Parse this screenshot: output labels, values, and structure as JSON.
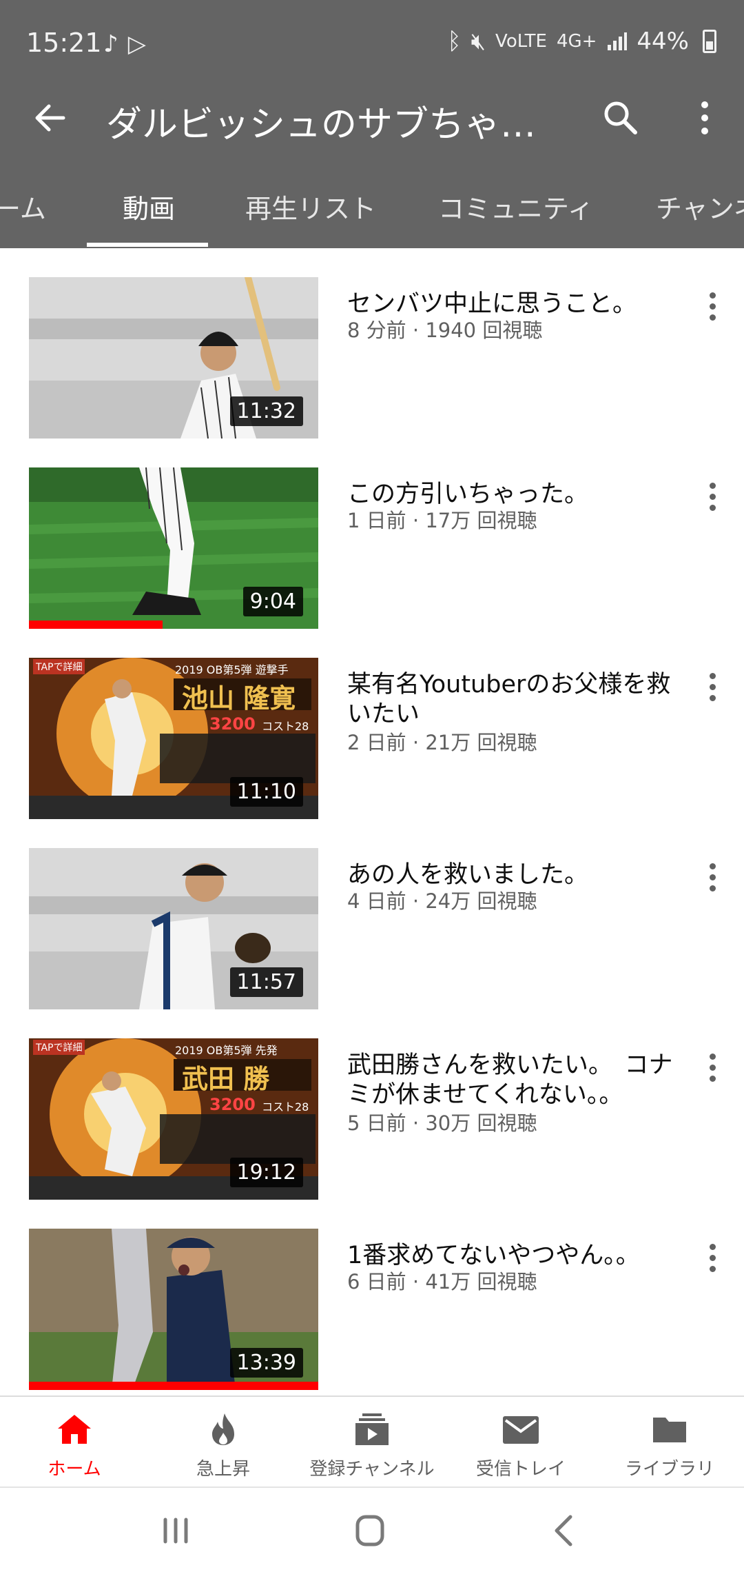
{
  "status_bar": {
    "time": "15:21",
    "network_label": "4G+",
    "volte_label": "VoLTE",
    "battery": "44%"
  },
  "app_bar": {
    "title": "ダルビッシュのサブちゃん…",
    "icons": [
      "back-arrow-icon",
      "search-icon",
      "more-vert-icon"
    ]
  },
  "tabs": [
    {
      "label": "ーム",
      "active": false
    },
    {
      "label": "動画",
      "active": true
    },
    {
      "label": "再生リスト",
      "active": false
    },
    {
      "label": "コミュニティ",
      "active": false
    },
    {
      "label": "チャンネ",
      "active": false
    }
  ],
  "videos": [
    {
      "title": "センバツ中止に思うこと。",
      "meta": "8 分前 · 1940 回視聴",
      "duration": "11:32",
      "watched": 0
    },
    {
      "title": "この方引いちゃった。",
      "meta": "1 日前 · 17万 回視聴",
      "duration": "9:04",
      "watched": 0.46
    },
    {
      "title": "某有名Youtuberのお父様を救いたい",
      "meta": "2 日前 · 21万 回視聴",
      "duration": "11:10",
      "watched": 0
    },
    {
      "title": "あの人を救いました。",
      "meta": "4 日前 · 24万 回視聴",
      "duration": "11:57",
      "watched": 0
    },
    {
      "title": "武田勝さんを救いたい。　コナミが休ませてくれない。。",
      "meta": "5 日前 · 30万 回視聴",
      "duration": "19:12",
      "watched": 0
    },
    {
      "title": "1番求めてないやつやん。。",
      "meta": "6 日前 · 41万 回視聴",
      "duration": "13:39",
      "watched": 1.0
    }
  ],
  "thumbnail_text": {
    "v3": {
      "tap": "TAPで詳細",
      "header": "2019 OB第5弾 遊撃手",
      "name": "池山 隆寛",
      "cost": "3200",
      "cost_label": "コスト28"
    },
    "v5": {
      "tap": "TAPで詳細",
      "header": "2019 OB第5弾 先発",
      "name": "武田 勝",
      "cost": "3200",
      "cost_label": "コスト28"
    }
  },
  "bottom_nav": [
    {
      "label": "ホーム",
      "icon": "home-icon",
      "active": true
    },
    {
      "label": "急上昇",
      "icon": "trending-flame-icon",
      "active": false
    },
    {
      "label": "登録チャンネル",
      "icon": "subscriptions-icon",
      "active": false
    },
    {
      "label": "受信トレイ",
      "icon": "inbox-mail-icon",
      "active": false
    },
    {
      "label": "ライブラリ",
      "icon": "library-folder-icon",
      "active": false
    }
  ],
  "colors": {
    "header_bg": "#646464",
    "accent": "#ff0000",
    "meta_text": "#606060"
  }
}
